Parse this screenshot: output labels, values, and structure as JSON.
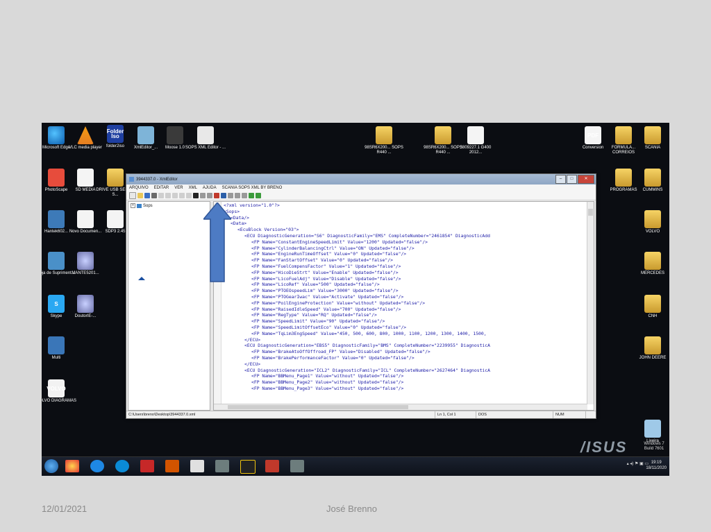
{
  "footer": {
    "date": "12/01/2021",
    "author": "José Brenno"
  },
  "desktop": {
    "icons_left": [
      {
        "label": "Microsoft Edge",
        "icon": "edge-icon"
      },
      {
        "label": "VLC media player",
        "icon": "vlc-icon"
      },
      {
        "label": "folder2iso",
        "icon": "folder2iso-icon",
        "glyph": "Folder Iso"
      },
      {
        "label": "XmlEditor_...",
        "icon": "xml-editor-icon"
      },
      {
        "label": "Moose 1.0",
        "icon": "moose-icon"
      },
      {
        "label": "SOPS XML Editor - ...",
        "icon": "sops-icon"
      },
      {
        "label": "PhotoScape",
        "icon": "photoscape-icon"
      },
      {
        "label": "SD MEDIA",
        "icon": "document-icon"
      },
      {
        "label": "DRIVE USB SERIAL S...",
        "icon": "folder-icon"
      },
      {
        "label": "Hantek602...",
        "icon": "computer-icon"
      },
      {
        "label": "Novo Documen...",
        "icon": "document-icon"
      },
      {
        "label": "SDP3 2.45",
        "icon": "document-icon"
      },
      {
        "label": "Loja de Supriment...",
        "icon": "printer-icon"
      },
      {
        "label": "MANTE5201...",
        "icon": "disc-icon"
      },
      {
        "label": "Skype",
        "icon": "skype-icon",
        "glyph": "S"
      },
      {
        "label": "DoutorIE-...",
        "icon": "disc-icon"
      },
      {
        "label": "Multi",
        "icon": "multi-icon"
      },
      {
        "label": "VOLVO DIAGRAMAS",
        "icon": "volvo-icon",
        "glyph": "VOLVO"
      }
    ],
    "icons_middle": [
      {
        "label": "98SR6X200... SOPS R440 ...",
        "icon": "folder-icon"
      },
      {
        "label": "98SR6X200... SOPS R440 ...",
        "icon": "folder-icon"
      },
      {
        "label": "3809227.1 G400 2012...",
        "icon": "document-icon"
      }
    ],
    "icons_right": [
      {
        "label": "Conversion",
        "icon": "pdf-icon",
        "glyph": "PDF"
      },
      {
        "label": "FORMULA... CORREIOS",
        "icon": "folder-icon"
      },
      {
        "label": "SCANIA",
        "icon": "folder-icon"
      },
      {
        "label": "PROGRAMAS",
        "icon": "folder-icon"
      },
      {
        "label": "CUMMINS",
        "icon": "folder-icon"
      },
      {
        "label": "VOLVO",
        "icon": "folder-icon"
      },
      {
        "label": "MERCEDES",
        "icon": "folder-icon"
      },
      {
        "label": "CNH",
        "icon": "folder-icon"
      },
      {
        "label": "JOHN DEERE",
        "icon": "folder-icon"
      },
      {
        "label": "Lixeira",
        "icon": "recycle-bin-icon"
      }
    ],
    "brand_logo": "/ISUS",
    "watermark": [
      "Windows 7",
      "Build 7601"
    ]
  },
  "window": {
    "title": "3944337.0 - XmlEditor",
    "menu": [
      "ARQUIVO",
      "EDITAR",
      "VER",
      "XML",
      "AJUDA",
      "SCANIA SOPS XML BY BRENO"
    ],
    "tree": {
      "root_label": "Sops",
      "expander": "+"
    },
    "code_lines": [
      {
        "indent": 0,
        "text": "<?xml version=\"1.0\"?>"
      },
      {
        "indent": 0,
        "text": "<Sops>"
      },
      {
        "indent": 1,
        "text": "<Data/>"
      },
      {
        "indent": 1,
        "text": "<Data>"
      },
      {
        "indent": 2,
        "text": "<EcuBlock Version=\"03\">"
      },
      {
        "indent": 3,
        "text": "<ECU DiagnosticGeneration=\"S6\" DiagnosticFamily=\"EMS\" CompleteNumber=\"2461854\" DiagnosticAdd"
      },
      {
        "indent": 4,
        "text": "<FP Name=\"ConstantEngineSpeedLimit\" Value=\"1200\" Updated=\"false\"/>"
      },
      {
        "indent": 4,
        "text": "<FP Name=\"CylinderBalancingCtrl\" Value=\"ON\" Updated=\"false\"/>"
      },
      {
        "indent": 4,
        "text": "<FP Name=\"EngineRunTimeOffset\" Value=\"0\" Updated=\"false\"/>"
      },
      {
        "indent": 4,
        "text": "<FP Name=\"FanStartOffset\" Value=\"0\" Updated=\"false\"/>"
      },
      {
        "indent": 4,
        "text": "<FP Name=\"FuelCompensFactor\" Value=\"1\" Updated=\"false\"/>"
      },
      {
        "indent": 4,
        "text": "<FP Name=\"HicoDieStrt\" Value=\"Enable\" Updated=\"false\"/>"
      },
      {
        "indent": 4,
        "text": "<FP Name=\"LicoFuelAdj\" Value=\"Disable\" Updated=\"false\"/>"
      },
      {
        "indent": 4,
        "text": "<FP Name=\"LicoRef\" Value=\"500\" Updated=\"false\"/>"
      },
      {
        "indent": 4,
        "text": "<FP Name=\"PTOEOspeedLim\" Value=\"3000\" Updated=\"false\"/>"
      },
      {
        "indent": 4,
        "text": "<FP Name=\"PTOGearIwac\" Value=\"Activate\" Updated=\"false\"/>"
      },
      {
        "indent": 4,
        "text": "<FP Name=\"PoilEngineProtection\" Value=\"without\" Updated=\"false\"/>"
      },
      {
        "indent": 4,
        "text": "<FP Name=\"RaisedIdleSpeed\" Value=\"700\" Updated=\"false\"/>"
      },
      {
        "indent": 4,
        "text": "<FP Name=\"RegType\" Value=\"RQ\" Updated=\"false\"/>"
      },
      {
        "indent": 4,
        "text": "<FP Name=\"SpeedLimit\" Value=\"90\" Updated=\"false\"/>"
      },
      {
        "indent": 4,
        "text": "<FP Name=\"SpeedLimitOffsetEco\" Value=\"0\" Updated=\"false\"/>"
      },
      {
        "indent": 4,
        "text": "<FP Name=\"TqLim3EngSpeed\" Value=\"450, 500, 600, 800, 1000, 1100, 1200, 1300, 1400, 1500,"
      },
      {
        "indent": 3,
        "text": "</ECU>"
      },
      {
        "indent": 3,
        "text": "<ECU DiagnosticGeneration=\"EBS5\" DiagnosticFamily=\"BMS\" CompleteNumber=\"2239955\" DiagnosticA"
      },
      {
        "indent": 4,
        "text": "<FP Name=\"BrakeAtoOffOffroad_FP\" Value=\"Disabled\" Updated=\"false\"/>"
      },
      {
        "indent": 4,
        "text": "<FP Name=\"BrakePerformanceFactor\" Value=\"0\" Updated=\"false\"/>"
      },
      {
        "indent": 3,
        "text": "</ECU>"
      },
      {
        "indent": 3,
        "text": "<ECU DiagnosticGeneration=\"ICL2\" DiagnosticFamily=\"ICL\" CompleteNumber=\"2627464\" DiagnosticA"
      },
      {
        "indent": 4,
        "text": "<FP Name=\"BBMenu_Page1\" Value=\"without\" Updated=\"false\"/>"
      },
      {
        "indent": 4,
        "text": "<FP Name=\"BBMenu_Page2\" Value=\"without\" Updated=\"false\"/>"
      },
      {
        "indent": 4,
        "text": "<FP Name=\"BBMenu_Page3\" Value=\"without\" Updated=\"false\"/>"
      }
    ],
    "status": {
      "path": "C:\\Users\\breno\\Desktop\\3944337.0.xml",
      "position": "Ln 1, Col 1",
      "line_ending": "DOS",
      "num_lock": "NUM"
    }
  },
  "taskbar": {
    "clock_time": "19:19",
    "clock_date": "18/11/2020"
  }
}
